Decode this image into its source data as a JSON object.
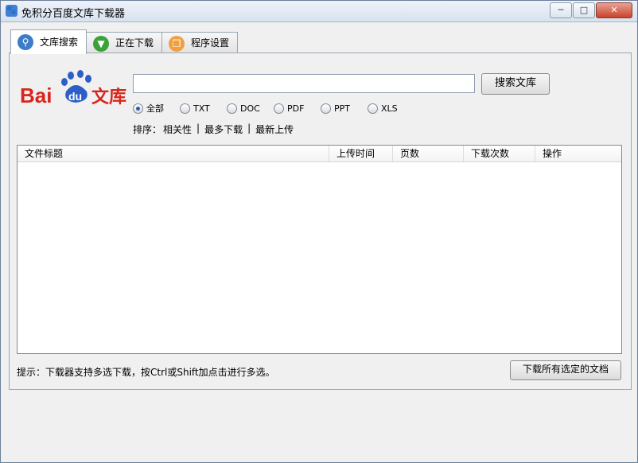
{
  "window": {
    "title": "免积分百度文库下载器",
    "minimize": "─",
    "maximize": "□",
    "close": "✕"
  },
  "tabs": [
    {
      "label": "文库搜索",
      "icon": "magnifier-icon",
      "glyph": "🔍",
      "color": "#3d7cc9"
    },
    {
      "label": "正在下载",
      "icon": "download-arrow-icon",
      "glyph": "▼",
      "color": "#3aa23a"
    },
    {
      "label": "程序设置",
      "icon": "settings-windows-icon",
      "glyph": "❐",
      "color": "#f0a040"
    }
  ],
  "logo": {
    "text_bai": "Bai",
    "text_du": "du",
    "text_wenku": "文库",
    "red": "#d7261c",
    "blue": "#2d5ec7"
  },
  "search": {
    "value": "",
    "placeholder": "",
    "button_label": "搜索文库"
  },
  "filters": [
    {
      "label": "全部",
      "checked": true
    },
    {
      "label": "TXT",
      "checked": false
    },
    {
      "label": "DOC",
      "checked": false
    },
    {
      "label": "PDF",
      "checked": false
    },
    {
      "label": "PPT",
      "checked": false
    },
    {
      "label": "XLS",
      "checked": false
    }
  ],
  "sort": {
    "label": "排序：",
    "options": [
      "相关性",
      "最多下载",
      "最新上传"
    ],
    "separator": "|"
  },
  "table": {
    "columns": [
      "文件标题",
      "上传时间",
      "页数",
      "下载次数",
      "操作"
    ],
    "rows": []
  },
  "footer": {
    "hint": "提示：下载器支持多选下载，按Ctrl或Shift加点击进行多选。",
    "download_button": "下载所有选定的文档"
  }
}
